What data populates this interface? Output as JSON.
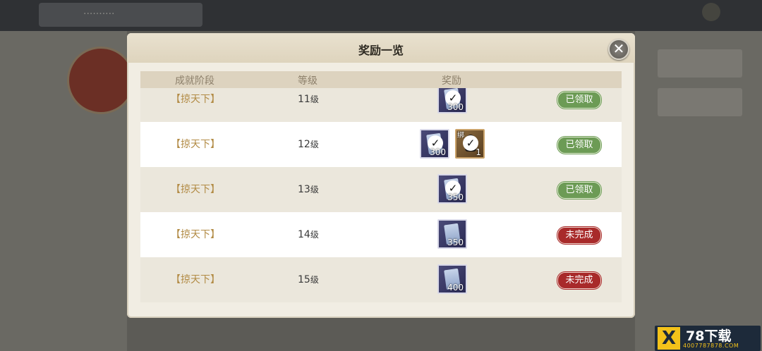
{
  "background": {
    "tab_label": "··········"
  },
  "dialog": {
    "title": "奖励一览",
    "close_icon": "close-icon"
  },
  "columns": {
    "stage": "成就阶段",
    "level": "等级",
    "reward": "奖励"
  },
  "rows": [
    {
      "stage": "【掠天下】",
      "level": "11",
      "level_unit": "级",
      "rewards": [
        {
          "icon": "scroll-item-icon",
          "count": "300",
          "claimed": true
        }
      ],
      "status": "已领取"
    },
    {
      "stage": "【掠天下】",
      "level": "12",
      "level_unit": "级",
      "rewards": [
        {
          "icon": "scroll-item-icon",
          "count": "300",
          "claimed": true
        },
        {
          "icon": "character-item-icon",
          "count": "1",
          "claimed": true,
          "tag": "绑"
        }
      ],
      "status": "已领取"
    },
    {
      "stage": "【掠天下】",
      "level": "13",
      "level_unit": "级",
      "rewards": [
        {
          "icon": "scroll-item-icon",
          "count": "350",
          "claimed": true
        }
      ],
      "status": "已领取"
    },
    {
      "stage": "【掠天下】",
      "level": "14",
      "level_unit": "级",
      "rewards": [
        {
          "icon": "scroll-item-icon",
          "count": "350",
          "claimed": false
        }
      ],
      "status": "未完成"
    },
    {
      "stage": "【掠天下】",
      "level": "15",
      "level_unit": "级",
      "rewards": [
        {
          "icon": "scroll-item-icon",
          "count": "400",
          "claimed": false
        }
      ],
      "status": "未完成"
    }
  ],
  "status_colors": {
    "claimed": "#6c9b55",
    "incomplete": "#a82a2a"
  },
  "watermark": {
    "logo": "X",
    "title": "78下载",
    "subtitle": "4007787878.COM"
  }
}
